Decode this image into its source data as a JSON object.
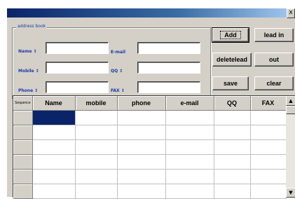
{
  "window": {
    "close_glyph": "x"
  },
  "group": {
    "legend": "address book",
    "fields": [
      {
        "label": "Name ↕",
        "value": ""
      },
      {
        "label": "E-mail",
        "value": ""
      },
      {
        "label": "Mobile ↕",
        "value": ""
      },
      {
        "label": "QQ ↕",
        "value": ""
      },
      {
        "label": "Phone ↕",
        "value": ""
      },
      {
        "label": "FAX ↕",
        "value": ""
      }
    ]
  },
  "buttons": {
    "add": "Add",
    "lead_in": "lead in",
    "deletelead": "deletelead",
    "out": "out",
    "save": "save",
    "clear": "clear"
  },
  "grid": {
    "columns": [
      "Sequence",
      "Name",
      "mobile",
      "phone",
      "e-mail",
      "QQ",
      "FAX"
    ],
    "row_count": 6
  },
  "scrollbar": {
    "up_glyph": "▲",
    "down_glyph": "▼"
  },
  "colors": {
    "title_bar": "#0a246a",
    "label_text": "#1a3aa8",
    "selection": "#0a246a",
    "face": "#d4d0c8"
  }
}
